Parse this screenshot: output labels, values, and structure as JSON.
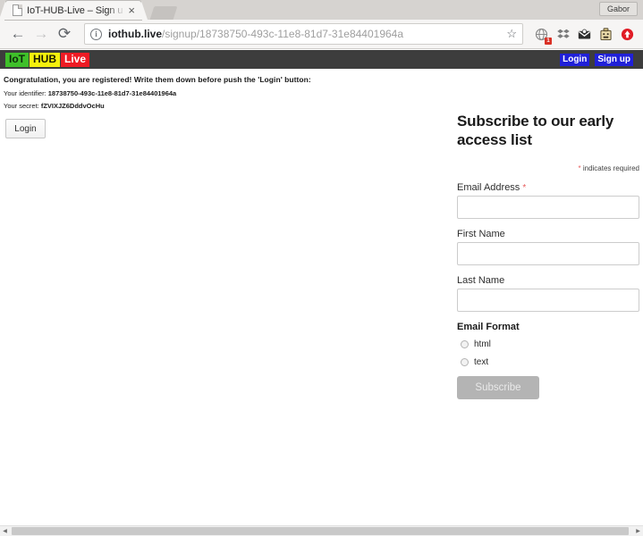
{
  "browser": {
    "tab": {
      "title": "IoT-HUB-Live – Sign u",
      "favicon_icon": "page-icon",
      "close_icon": "×"
    },
    "profile_name": "Gabor",
    "nav": {
      "back_icon": "←",
      "forward_icon": "→",
      "reload_icon": "⟳"
    },
    "omnibox": {
      "info_icon": "i",
      "host": "iothub.live",
      "path": "/signup/18738750-493c-11e8-81d7-31e84401964a",
      "star_icon": "☆"
    },
    "extensions": [
      {
        "name": "translate-extension-icon",
        "glyph": "🌐",
        "badge": "1"
      },
      {
        "name": "dropbox-extension-icon",
        "glyph": "⁑",
        "badge": ""
      },
      {
        "name": "mail-extension-icon",
        "glyph": "✉",
        "badge": ""
      },
      {
        "name": "password-manager-extension-icon",
        "glyph": "🔒",
        "badge": ""
      },
      {
        "name": "upload-extension-icon",
        "glyph": "⬆",
        "badge": ""
      }
    ]
  },
  "site": {
    "brand": {
      "part1": "IoT",
      "part2": "HUB",
      "part3": "Live"
    },
    "nav_links": [
      {
        "label": "Login"
      },
      {
        "label": "Sign up"
      }
    ],
    "colors": {
      "brand_green": "#3fc02a",
      "brand_yellow": "#f5f10d",
      "brand_red": "#ee1b24",
      "navbar_dark": "#3d3d3d",
      "link_highlight": "#2020d8",
      "required_asterisk": "#e85c5c",
      "subscribe_button": "#b4b4b4"
    }
  },
  "message": {
    "headline": "Congratulation, you are registered! Write them down before push the 'Login' button:",
    "identifier_label": "Your identifier:",
    "identifier_value": "18738750-493c-11e8-81d7-31e84401964a",
    "secret_label": "Your secret:",
    "secret_value": "fZVIXJZ6DddvOcHu",
    "login_button": "Login"
  },
  "subscribe": {
    "title": "Subscribe to our early access list",
    "required_note_asterisk": "*",
    "required_note": "indicates required",
    "fields": [
      {
        "label": "Email Address",
        "required": true,
        "value": "",
        "placeholder": ""
      },
      {
        "label": "First Name",
        "required": false,
        "value": "",
        "placeholder": ""
      },
      {
        "label": "Last Name",
        "required": false,
        "value": "",
        "placeholder": ""
      }
    ],
    "format_title": "Email Format",
    "format_options": [
      {
        "label": "html",
        "selected": false
      },
      {
        "label": "text",
        "selected": false
      }
    ],
    "submit_label": "Subscribe"
  },
  "scrollbar": {
    "left_arrow": "◀",
    "right_arrow": "▶"
  }
}
